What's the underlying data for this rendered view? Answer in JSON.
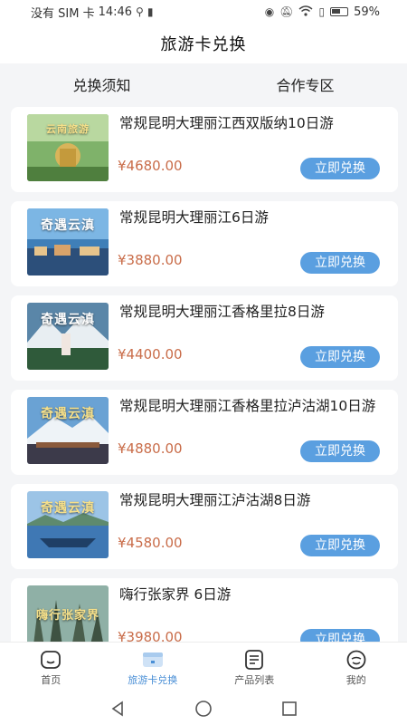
{
  "status_bar": {
    "carrier": "没有 SIM 卡",
    "time": "14:46",
    "battery": "59%"
  },
  "header": {
    "title": "旅游卡兑换"
  },
  "tabs": [
    {
      "label": "兑换须知"
    },
    {
      "label": "合作专区"
    }
  ],
  "products": [
    {
      "title": "常规昆明大理丽江西双版纳10日游",
      "price": "¥4680.00",
      "button": "立即兑换",
      "thumb_text": "云南旅游",
      "thumb_theme": "temple"
    },
    {
      "title": "常规昆明大理丽江6日游",
      "price": "¥3880.00",
      "button": "立即兑换",
      "thumb_text": "奇遇云滇",
      "thumb_theme": "town"
    },
    {
      "title": "常规昆明大理丽江香格里拉8日游",
      "price": "¥4400.00",
      "button": "立即兑换",
      "thumb_text": "奇遇云滇",
      "thumb_theme": "mountain"
    },
    {
      "title": "常规昆明大理丽江香格里拉泸沽湖10日游",
      "price": "¥4880.00",
      "button": "立即兑换",
      "thumb_text": "奇遇云滇",
      "thumb_theme": "snowtown"
    },
    {
      "title": "常规昆明大理丽江泸沽湖8日游",
      "price": "¥4580.00",
      "button": "立即兑换",
      "thumb_text": "奇遇云滇",
      "thumb_theme": "lake"
    },
    {
      "title": "嗨行张家界 6日游",
      "price": "¥3980.00",
      "button": "立即兑换",
      "thumb_text": "嗨行张家界",
      "thumb_theme": "peaks"
    }
  ],
  "bottom_nav": [
    {
      "label": "首页",
      "icon": "home-icon"
    },
    {
      "label": "旅游卡兑换",
      "icon": "card-icon",
      "active": true
    },
    {
      "label": "产品列表",
      "icon": "list-icon"
    },
    {
      "label": "我的",
      "icon": "profile-icon"
    }
  ],
  "colors": {
    "accent": "#5a9fe0",
    "active_nav": "#4a8fd6",
    "price": "#c96d4a",
    "background": "#f4f5f7"
  }
}
